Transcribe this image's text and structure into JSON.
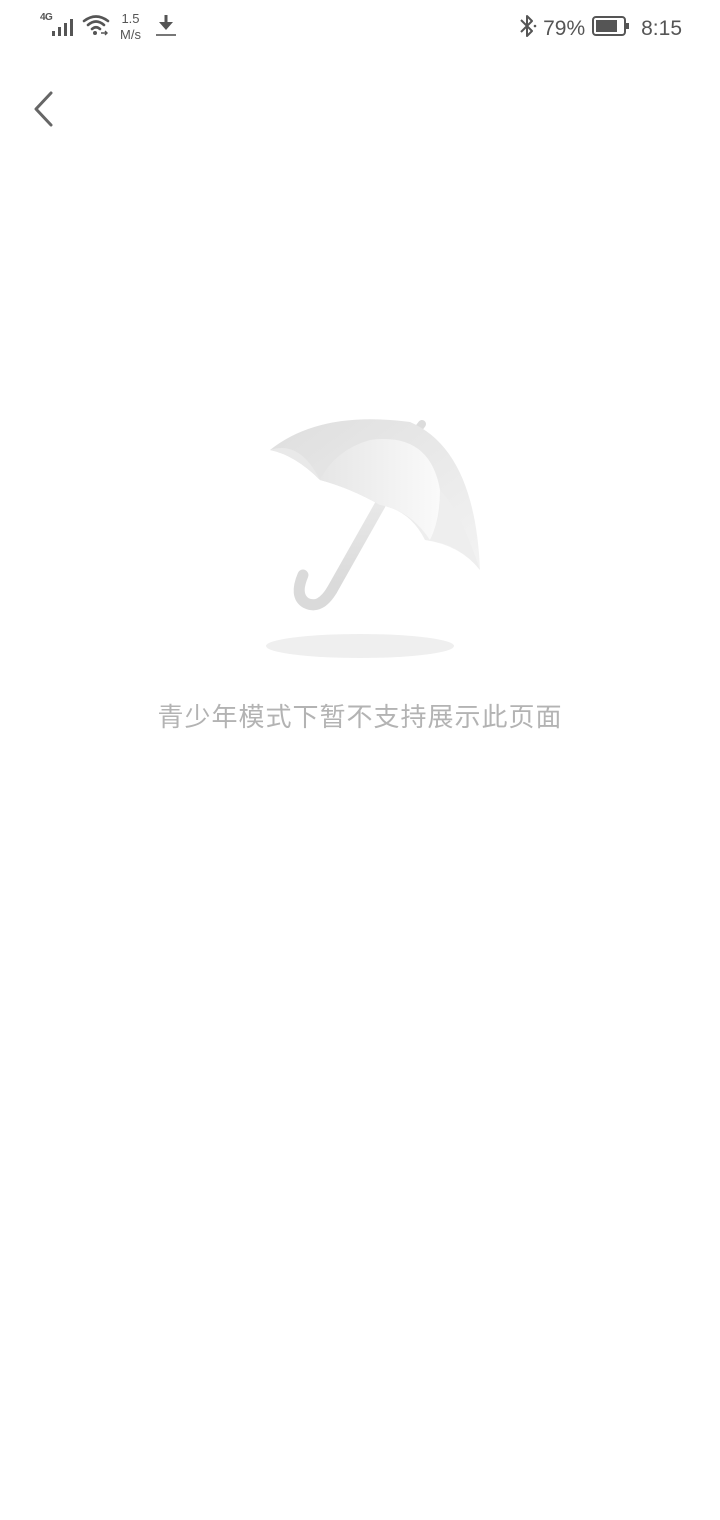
{
  "status_bar": {
    "network_type": "4G",
    "speed_value": "1.5",
    "speed_unit": "M/s",
    "battery_percent": "79%",
    "time": "8:15",
    "icons": [
      "signal-icon",
      "wifi-icon",
      "download-icon",
      "bluetooth-icon",
      "battery-icon"
    ]
  },
  "header": {
    "back_icon": "chevron-left-icon"
  },
  "empty_state": {
    "illustration": "umbrella-icon",
    "message": "青少年模式下暂不支持展示此页面"
  }
}
